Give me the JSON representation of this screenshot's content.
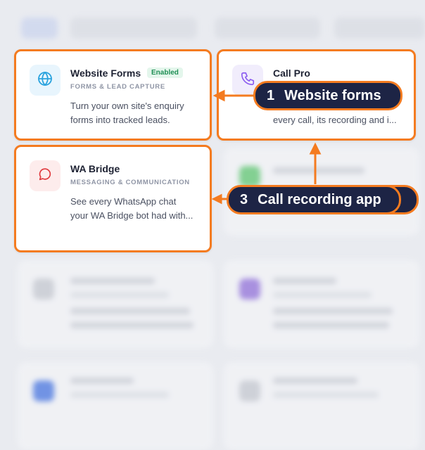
{
  "cards": [
    {
      "title": "Website Forms",
      "badge": "Enabled",
      "category": "FORMS & LEAD CAPTURE",
      "desc_line1": "Turn your own site's enquiry",
      "desc_line2": "forms into tracked leads.",
      "icon": "globe-icon"
    },
    {
      "title": "Call Pro",
      "desc_line2": "every call, its recording and i...",
      "icon": "phone-icon"
    },
    {
      "title": "WA Bridge",
      "category": "MESSAGING & COMMUNICATION",
      "desc_line1": "See every WhatsApp chat",
      "desc_line2": "your WA Bridge bot had with...",
      "icon": "chat-bubble-icon"
    }
  ],
  "callouts": [
    {
      "num": "1",
      "label": "Website forms"
    },
    {
      "num": "3",
      "label": "Call recording app"
    }
  ],
  "colors": {
    "highlight": "#f47b20",
    "callout_bg": "#1d2445",
    "badge_green": "#1f8f55"
  }
}
